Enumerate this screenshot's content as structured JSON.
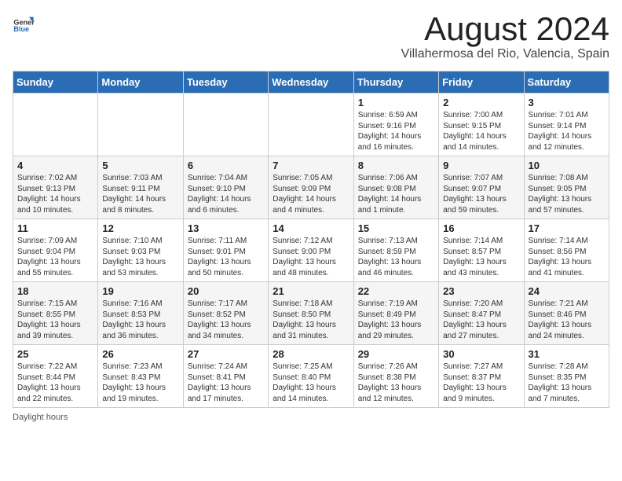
{
  "header": {
    "logo_general": "General",
    "logo_blue": "Blue",
    "title": "August 2024",
    "subtitle": "Villahermosa del Rio, Valencia, Spain"
  },
  "days_of_week": [
    "Sunday",
    "Monday",
    "Tuesday",
    "Wednesday",
    "Thursday",
    "Friday",
    "Saturday"
  ],
  "weeks": [
    [
      {
        "day": "",
        "info": ""
      },
      {
        "day": "",
        "info": ""
      },
      {
        "day": "",
        "info": ""
      },
      {
        "day": "",
        "info": ""
      },
      {
        "day": "1",
        "info": "Sunrise: 6:59 AM\nSunset: 9:16 PM\nDaylight: 14 hours and 16 minutes."
      },
      {
        "day": "2",
        "info": "Sunrise: 7:00 AM\nSunset: 9:15 PM\nDaylight: 14 hours and 14 minutes."
      },
      {
        "day": "3",
        "info": "Sunrise: 7:01 AM\nSunset: 9:14 PM\nDaylight: 14 hours and 12 minutes."
      }
    ],
    [
      {
        "day": "4",
        "info": "Sunrise: 7:02 AM\nSunset: 9:13 PM\nDaylight: 14 hours and 10 minutes."
      },
      {
        "day": "5",
        "info": "Sunrise: 7:03 AM\nSunset: 9:11 PM\nDaylight: 14 hours and 8 minutes."
      },
      {
        "day": "6",
        "info": "Sunrise: 7:04 AM\nSunset: 9:10 PM\nDaylight: 14 hours and 6 minutes."
      },
      {
        "day": "7",
        "info": "Sunrise: 7:05 AM\nSunset: 9:09 PM\nDaylight: 14 hours and 4 minutes."
      },
      {
        "day": "8",
        "info": "Sunrise: 7:06 AM\nSunset: 9:08 PM\nDaylight: 14 hours and 1 minute."
      },
      {
        "day": "9",
        "info": "Sunrise: 7:07 AM\nSunset: 9:07 PM\nDaylight: 13 hours and 59 minutes."
      },
      {
        "day": "10",
        "info": "Sunrise: 7:08 AM\nSunset: 9:05 PM\nDaylight: 13 hours and 57 minutes."
      }
    ],
    [
      {
        "day": "11",
        "info": "Sunrise: 7:09 AM\nSunset: 9:04 PM\nDaylight: 13 hours and 55 minutes."
      },
      {
        "day": "12",
        "info": "Sunrise: 7:10 AM\nSunset: 9:03 PM\nDaylight: 13 hours and 53 minutes."
      },
      {
        "day": "13",
        "info": "Sunrise: 7:11 AM\nSunset: 9:01 PM\nDaylight: 13 hours and 50 minutes."
      },
      {
        "day": "14",
        "info": "Sunrise: 7:12 AM\nSunset: 9:00 PM\nDaylight: 13 hours and 48 minutes."
      },
      {
        "day": "15",
        "info": "Sunrise: 7:13 AM\nSunset: 8:59 PM\nDaylight: 13 hours and 46 minutes."
      },
      {
        "day": "16",
        "info": "Sunrise: 7:14 AM\nSunset: 8:57 PM\nDaylight: 13 hours and 43 minutes."
      },
      {
        "day": "17",
        "info": "Sunrise: 7:14 AM\nSunset: 8:56 PM\nDaylight: 13 hours and 41 minutes."
      }
    ],
    [
      {
        "day": "18",
        "info": "Sunrise: 7:15 AM\nSunset: 8:55 PM\nDaylight: 13 hours and 39 minutes."
      },
      {
        "day": "19",
        "info": "Sunrise: 7:16 AM\nSunset: 8:53 PM\nDaylight: 13 hours and 36 minutes."
      },
      {
        "day": "20",
        "info": "Sunrise: 7:17 AM\nSunset: 8:52 PM\nDaylight: 13 hours and 34 minutes."
      },
      {
        "day": "21",
        "info": "Sunrise: 7:18 AM\nSunset: 8:50 PM\nDaylight: 13 hours and 31 minutes."
      },
      {
        "day": "22",
        "info": "Sunrise: 7:19 AM\nSunset: 8:49 PM\nDaylight: 13 hours and 29 minutes."
      },
      {
        "day": "23",
        "info": "Sunrise: 7:20 AM\nSunset: 8:47 PM\nDaylight: 13 hours and 27 minutes."
      },
      {
        "day": "24",
        "info": "Sunrise: 7:21 AM\nSunset: 8:46 PM\nDaylight: 13 hours and 24 minutes."
      }
    ],
    [
      {
        "day": "25",
        "info": "Sunrise: 7:22 AM\nSunset: 8:44 PM\nDaylight: 13 hours and 22 minutes."
      },
      {
        "day": "26",
        "info": "Sunrise: 7:23 AM\nSunset: 8:43 PM\nDaylight: 13 hours and 19 minutes."
      },
      {
        "day": "27",
        "info": "Sunrise: 7:24 AM\nSunset: 8:41 PM\nDaylight: 13 hours and 17 minutes."
      },
      {
        "day": "28",
        "info": "Sunrise: 7:25 AM\nSunset: 8:40 PM\nDaylight: 13 hours and 14 minutes."
      },
      {
        "day": "29",
        "info": "Sunrise: 7:26 AM\nSunset: 8:38 PM\nDaylight: 13 hours and 12 minutes."
      },
      {
        "day": "30",
        "info": "Sunrise: 7:27 AM\nSunset: 8:37 PM\nDaylight: 13 hours and 9 minutes."
      },
      {
        "day": "31",
        "info": "Sunrise: 7:28 AM\nSunset: 8:35 PM\nDaylight: 13 hours and 7 minutes."
      }
    ]
  ],
  "footer": "Daylight hours"
}
